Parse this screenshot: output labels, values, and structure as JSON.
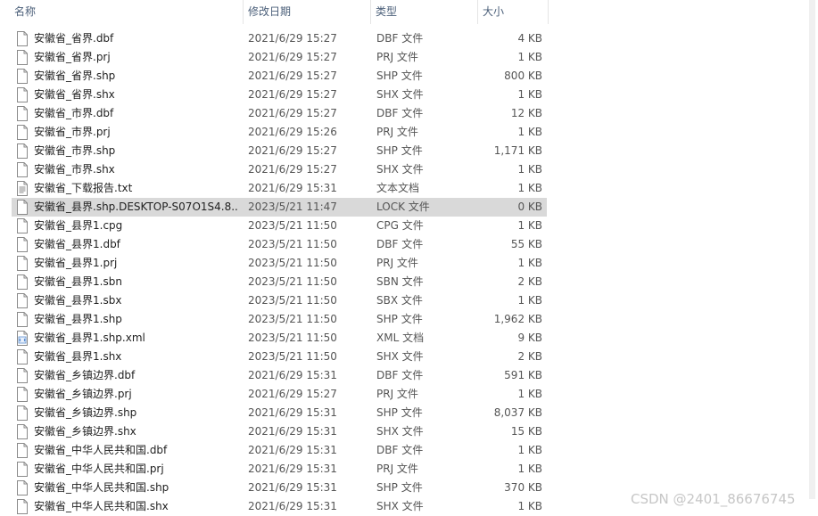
{
  "header": {
    "name": "名称",
    "date": "修改日期",
    "type": "类型",
    "size": "大小",
    "sort_icon": "chevron-up-icon"
  },
  "files": [
    {
      "name": "安徽省_省界.dbf",
      "date": "2021/6/29 15:27",
      "type": "DBF 文件",
      "size": "4 KB",
      "icon": "file-icon"
    },
    {
      "name": "安徽省_省界.prj",
      "date": "2021/6/29 15:27",
      "type": "PRJ 文件",
      "size": "1 KB",
      "icon": "file-icon"
    },
    {
      "name": "安徽省_省界.shp",
      "date": "2021/6/29 15:27",
      "type": "SHP 文件",
      "size": "800 KB",
      "icon": "file-icon"
    },
    {
      "name": "安徽省_省界.shx",
      "date": "2021/6/29 15:27",
      "type": "SHX 文件",
      "size": "1 KB",
      "icon": "file-icon"
    },
    {
      "name": "安徽省_市界.dbf",
      "date": "2021/6/29 15:27",
      "type": "DBF 文件",
      "size": "12 KB",
      "icon": "file-icon"
    },
    {
      "name": "安徽省_市界.prj",
      "date": "2021/6/29 15:26",
      "type": "PRJ 文件",
      "size": "1 KB",
      "icon": "file-icon"
    },
    {
      "name": "安徽省_市界.shp",
      "date": "2021/6/29 15:27",
      "type": "SHP 文件",
      "size": "1,171 KB",
      "icon": "file-icon"
    },
    {
      "name": "安徽省_市界.shx",
      "date": "2021/6/29 15:27",
      "type": "SHX 文件",
      "size": "1 KB",
      "icon": "file-icon"
    },
    {
      "name": "安徽省_下载报告.txt",
      "date": "2021/6/29 15:31",
      "type": "文本文档",
      "size": "1 KB",
      "icon": "text-file-icon"
    },
    {
      "name": "安徽省_县界.shp.DESKTOP-S07O1S4.8...",
      "date": "2023/5/21 11:47",
      "type": "LOCK 文件",
      "size": "0 KB",
      "icon": "file-icon",
      "selected": true
    },
    {
      "name": "安徽省_县界1.cpg",
      "date": "2023/5/21 11:50",
      "type": "CPG 文件",
      "size": "1 KB",
      "icon": "file-icon"
    },
    {
      "name": "安徽省_县界1.dbf",
      "date": "2023/5/21 11:50",
      "type": "DBF 文件",
      "size": "55 KB",
      "icon": "file-icon"
    },
    {
      "name": "安徽省_县界1.prj",
      "date": "2023/5/21 11:50",
      "type": "PRJ 文件",
      "size": "1 KB",
      "icon": "file-icon"
    },
    {
      "name": "安徽省_县界1.sbn",
      "date": "2023/5/21 11:50",
      "type": "SBN 文件",
      "size": "2 KB",
      "icon": "file-icon"
    },
    {
      "name": "安徽省_县界1.sbx",
      "date": "2023/5/21 11:50",
      "type": "SBX 文件",
      "size": "1 KB",
      "icon": "file-icon"
    },
    {
      "name": "安徽省_县界1.shp",
      "date": "2023/5/21 11:50",
      "type": "SHP 文件",
      "size": "1,962 KB",
      "icon": "file-icon"
    },
    {
      "name": "安徽省_县界1.shp.xml",
      "date": "2023/5/21 11:50",
      "type": "XML 文档",
      "size": "9 KB",
      "icon": "xml-file-icon"
    },
    {
      "name": "安徽省_县界1.shx",
      "date": "2023/5/21 11:50",
      "type": "SHX 文件",
      "size": "2 KB",
      "icon": "file-icon"
    },
    {
      "name": "安徽省_乡镇边界.dbf",
      "date": "2021/6/29 15:31",
      "type": "DBF 文件",
      "size": "591 KB",
      "icon": "file-icon"
    },
    {
      "name": "安徽省_乡镇边界.prj",
      "date": "2021/6/29 15:27",
      "type": "PRJ 文件",
      "size": "1 KB",
      "icon": "file-icon"
    },
    {
      "name": "安徽省_乡镇边界.shp",
      "date": "2021/6/29 15:31",
      "type": "SHP 文件",
      "size": "8,037 KB",
      "icon": "file-icon"
    },
    {
      "name": "安徽省_乡镇边界.shx",
      "date": "2021/6/29 15:31",
      "type": "SHX 文件",
      "size": "15 KB",
      "icon": "file-icon"
    },
    {
      "name": "安徽省_中华人民共和国.dbf",
      "date": "2021/6/29 15:31",
      "type": "DBF 文件",
      "size": "1 KB",
      "icon": "file-icon"
    },
    {
      "name": "安徽省_中华人民共和国.prj",
      "date": "2021/6/29 15:31",
      "type": "PRJ 文件",
      "size": "1 KB",
      "icon": "file-icon"
    },
    {
      "name": "安徽省_中华人民共和国.shp",
      "date": "2021/6/29 15:31",
      "type": "SHP 文件",
      "size": "370 KB",
      "icon": "file-icon"
    },
    {
      "name": "安徽省_中华人民共和国.shx",
      "date": "2021/6/29 15:31",
      "type": "SHX 文件",
      "size": "1 KB",
      "icon": "file-icon"
    }
  ],
  "watermark": "CSDN @2401_86676745",
  "colors": {
    "selected_row": "#d9d9d9",
    "header_text": "#4c607a"
  }
}
